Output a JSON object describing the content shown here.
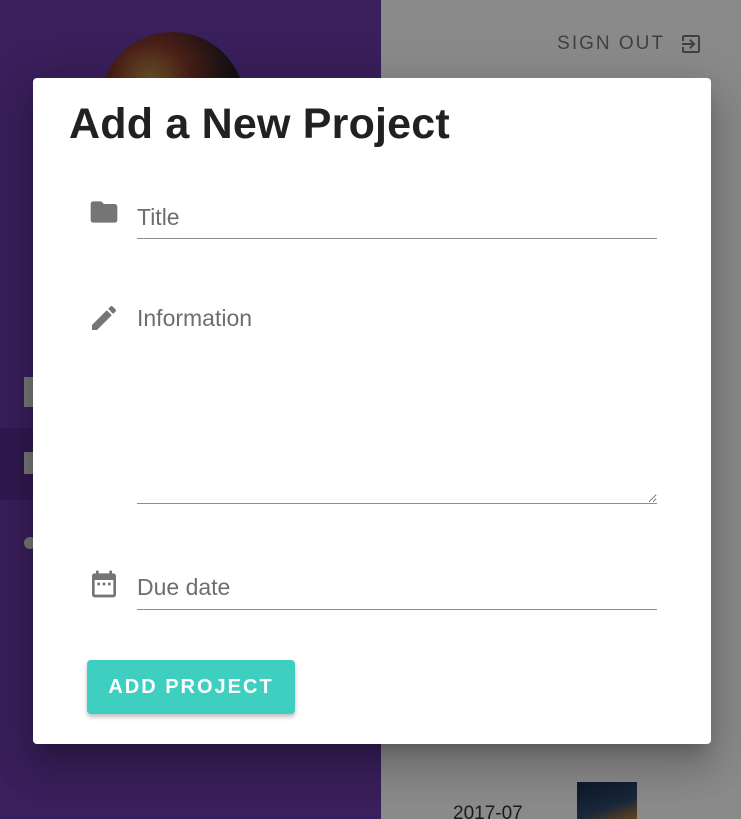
{
  "header": {
    "signout_label": "SIGN OUT",
    "signout_icon": "exit-icon"
  },
  "background": {
    "project_date": "2017-07"
  },
  "dialog": {
    "title": "Add a New Project",
    "fields": {
      "title": {
        "placeholder": "Title",
        "value": "",
        "icon": "folder-icon"
      },
      "information": {
        "placeholder": "Information",
        "value": "",
        "icon": "pencil-icon"
      },
      "due_date": {
        "placeholder": "Due date",
        "value": "",
        "icon": "calendar-icon"
      }
    },
    "submit_label": "ADD PROJECT"
  },
  "colors": {
    "sidebar": "#6a3aa8",
    "accent_button": "#3ecfc1",
    "overlay": "rgba(0,0,0,0.46)"
  }
}
